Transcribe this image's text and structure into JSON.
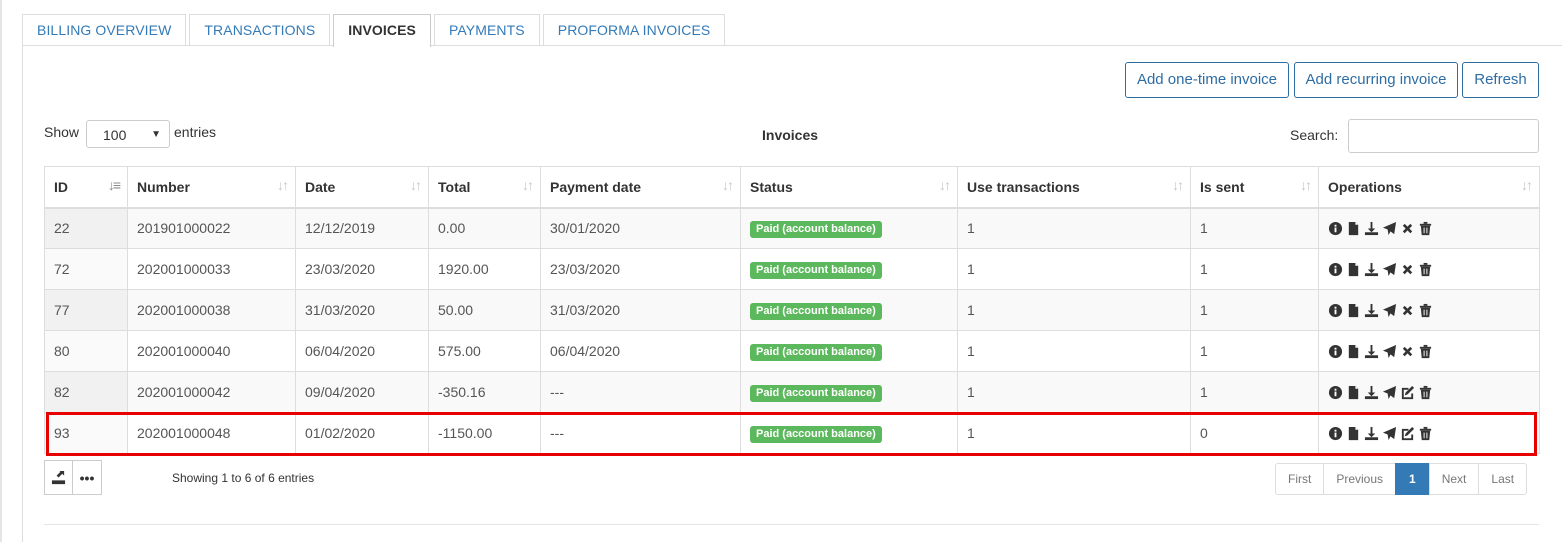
{
  "tabs": [
    {
      "label": "BILLING OVERVIEW",
      "active": false
    },
    {
      "label": "TRANSACTIONS",
      "active": false
    },
    {
      "label": "INVOICES",
      "active": true
    },
    {
      "label": "PAYMENTS",
      "active": false
    },
    {
      "label": "PROFORMA INVOICES",
      "active": false
    }
  ],
  "toolbar": {
    "add_one_time": "Add one-time invoice",
    "add_recurring": "Add recurring invoice",
    "refresh": "Refresh"
  },
  "length_control": {
    "show_label": "Show",
    "selected": "100",
    "entries_label": "entries"
  },
  "table_title": "Invoices",
  "search": {
    "label": "Search:",
    "value": ""
  },
  "columns": [
    "ID",
    "Number",
    "Date",
    "Total",
    "Payment date",
    "Status",
    "Use transactions",
    "Is sent",
    "Operations"
  ],
  "rows": [
    {
      "id": "22",
      "number": "201901000022",
      "date": "12/12/2019",
      "total": "0.00",
      "payment_date": "30/01/2020",
      "status": "Paid (account balance)",
      "use_transactions": "1",
      "is_sent": "1",
      "ops": [
        "info-icon",
        "file-icon",
        "download-icon",
        "send-icon",
        "cancel-icon",
        "trash-icon"
      ]
    },
    {
      "id": "72",
      "number": "202001000033",
      "date": "23/03/2020",
      "total": "1920.00",
      "payment_date": "23/03/2020",
      "status": "Paid (account balance)",
      "use_transactions": "1",
      "is_sent": "1",
      "ops": [
        "info-icon",
        "file-icon",
        "download-icon",
        "send-icon",
        "cancel-icon",
        "trash-icon"
      ]
    },
    {
      "id": "77",
      "number": "202001000038",
      "date": "31/03/2020",
      "total": "50.00",
      "payment_date": "31/03/2020",
      "status": "Paid (account balance)",
      "use_transactions": "1",
      "is_sent": "1",
      "ops": [
        "info-icon",
        "file-icon",
        "download-icon",
        "send-icon",
        "cancel-icon",
        "trash-icon"
      ]
    },
    {
      "id": "80",
      "number": "202001000040",
      "date": "06/04/2020",
      "total": "575.00",
      "payment_date": "06/04/2020",
      "status": "Paid (account balance)",
      "use_transactions": "1",
      "is_sent": "1",
      "ops": [
        "info-icon",
        "file-icon",
        "download-icon",
        "send-icon",
        "cancel-icon",
        "trash-icon"
      ]
    },
    {
      "id": "82",
      "number": "202001000042",
      "date": "09/04/2020",
      "total": "-350.16",
      "payment_date": "---",
      "status": "Paid (account balance)",
      "use_transactions": "1",
      "is_sent": "1",
      "ops": [
        "info-icon",
        "file-icon",
        "download-icon",
        "send-icon",
        "edit-icon",
        "trash-icon"
      ]
    },
    {
      "id": "93",
      "number": "202001000048",
      "date": "01/02/2020",
      "total": "-1150.00",
      "payment_date": "---",
      "status": "Paid (account balance)",
      "use_transactions": "1",
      "is_sent": "0",
      "ops": [
        "info-icon",
        "file-icon",
        "download-icon",
        "send-icon",
        "edit-icon",
        "trash-icon"
      ]
    }
  ],
  "highlighted_row_index": 5,
  "info": "Showing 1 to 6 of 6 entries",
  "pagination": {
    "first": "First",
    "previous": "Previous",
    "current": "1",
    "next": "Next",
    "last": "Last"
  },
  "colors": {
    "status_badge": "#5cb85c",
    "link_blue": "#337ab7",
    "highlight_border": "#e60000"
  }
}
